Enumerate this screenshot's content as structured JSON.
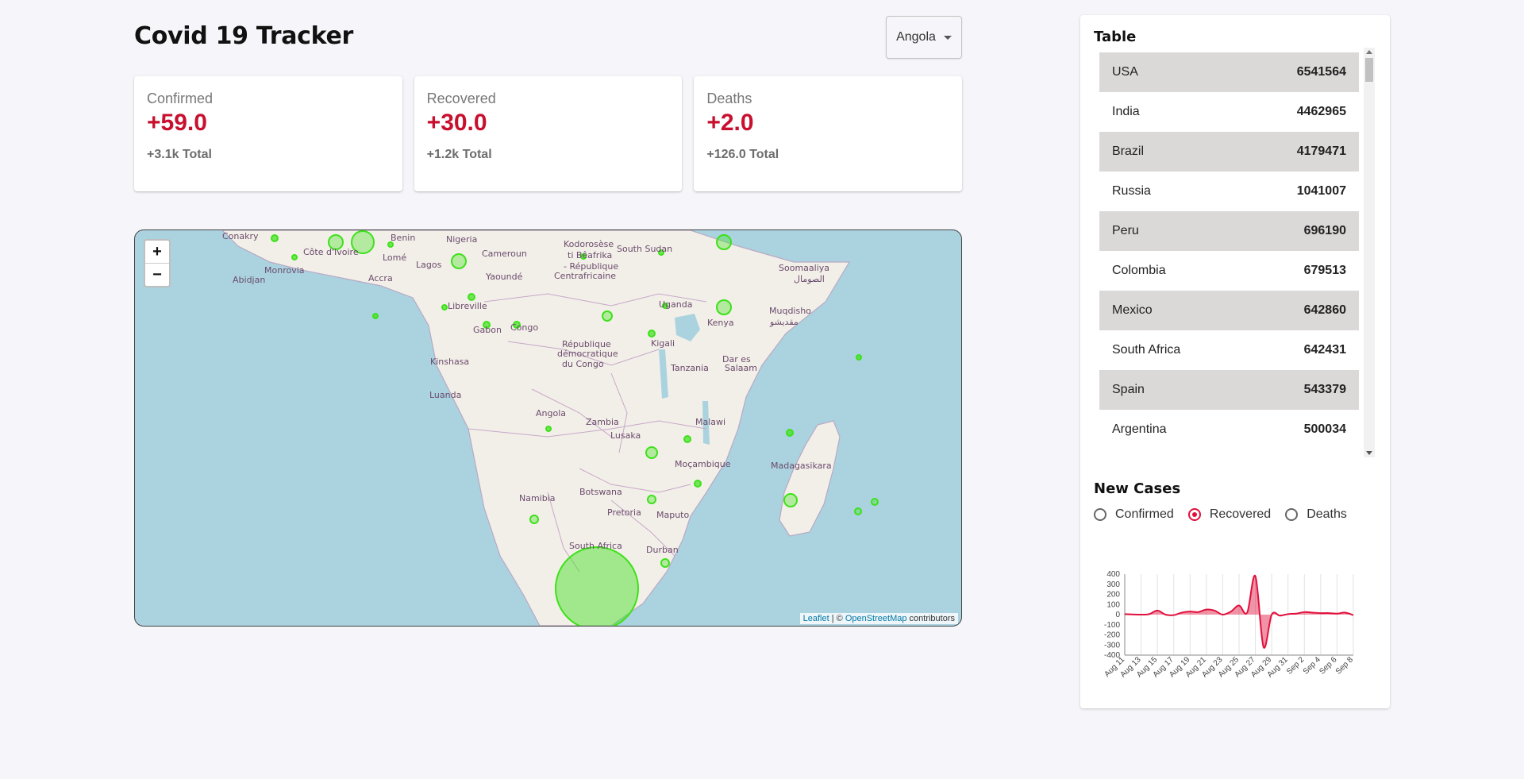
{
  "header": {
    "title": "Covid 19 Tracker",
    "country_selected": "Angola"
  },
  "cards": [
    {
      "label": "Confirmed",
      "value": "+59.0",
      "total": "+3.1k Total"
    },
    {
      "label": "Recovered",
      "value": "+30.0",
      "total": "+1.2k Total"
    },
    {
      "label": "Deaths",
      "value": "+2.0",
      "total": "+126.0 Total"
    }
  ],
  "map": {
    "zoom_in": "+",
    "zoom_out": "−",
    "attribution_leaflet": "Leaflet",
    "attribution_sep": " | © ",
    "attribution_osm": "OpenStreetMap",
    "attribution_suffix": " contributors",
    "labels": [
      "Conakry",
      "Côte d'Ivoire",
      "Benin",
      "Nigeria",
      "Monrovia",
      "Lomé",
      "Abidjan",
      "Accra",
      "Lagos",
      "Kodorosèse",
      "ti Bêafrika",
      "- République",
      "Centrafricaine",
      "Cameroun",
      "Yaoundé",
      "South Sudan",
      "Soomaaliya",
      "الصومال",
      "Libreville",
      "Gabon",
      "Congo",
      "Uganda",
      "Kenya",
      "Muqdisho",
      "مقديشو",
      "République",
      "démocratique",
      "du Congo",
      "Kigali",
      "Kinshasa",
      "Tanzania",
      "Dar es",
      "Salaam",
      "Luanda",
      "Angola",
      "Zambia",
      "Lusaka",
      "Malawi",
      "Moçambique",
      "Madagasikara",
      "Namibia",
      "Botswana",
      "Pretoria",
      "Maputo",
      "South Africa",
      "Durban"
    ],
    "marker_color": "#3ee11a"
  },
  "table": {
    "title": "Table",
    "rows": [
      {
        "country": "USA",
        "cases": "6541564"
      },
      {
        "country": "India",
        "cases": "4462965"
      },
      {
        "country": "Brazil",
        "cases": "4179471"
      },
      {
        "country": "Russia",
        "cases": "1041007"
      },
      {
        "country": "Peru",
        "cases": "696190"
      },
      {
        "country": "Colombia",
        "cases": "679513"
      },
      {
        "country": "Mexico",
        "cases": "642860"
      },
      {
        "country": "South Africa",
        "cases": "642431"
      },
      {
        "country": "Spain",
        "cases": "543379"
      },
      {
        "country": "Argentina",
        "cases": "500034"
      }
    ]
  },
  "new_cases": {
    "title": "New Cases",
    "options": [
      "Confirmed",
      "Recovered",
      "Deaths"
    ],
    "selected": "Recovered",
    "accent_color": "#e0103c"
  },
  "chart_data": {
    "type": "area",
    "title": "",
    "xlabel": "",
    "ylabel": "",
    "ylim": [
      -400,
      400
    ],
    "yticks": [
      400,
      300,
      200,
      100,
      0,
      -100,
      -200,
      -300,
      -400
    ],
    "x": [
      "Aug 11",
      "Aug 12",
      "Aug 13",
      "Aug 14",
      "Aug 15",
      "Aug 16",
      "Aug 17",
      "Aug 18",
      "Aug 19",
      "Aug 20",
      "Aug 21",
      "Aug 22",
      "Aug 23",
      "Aug 24",
      "Aug 25",
      "Aug 26",
      "Aug 27",
      "Aug 28",
      "Aug 29",
      "Aug 30",
      "Aug 31",
      "Sep 1",
      "Sep 2",
      "Sep 3",
      "Sep 4",
      "Sep 5",
      "Sep 6",
      "Sep 7",
      "Sep 8"
    ],
    "xtick_labels": [
      "Aug 11",
      "Aug 13",
      "Aug 15",
      "Aug 17",
      "Aug 19",
      "Aug 21",
      "Aug 23",
      "Aug 25",
      "Aug 27",
      "Aug 29",
      "Aug 31",
      "Sep 2",
      "Sep 4",
      "Sep 6",
      "Sep 8"
    ],
    "series": [
      {
        "values": [
          5,
          2,
          0,
          5,
          40,
          0,
          -5,
          20,
          30,
          25,
          50,
          40,
          0,
          30,
          90,
          20,
          380,
          -320,
          0,
          -10,
          5,
          10,
          25,
          20,
          15,
          15,
          10,
          20,
          -5
        ],
        "color": "#e0103c"
      }
    ],
    "grid": true,
    "legend": "none"
  }
}
